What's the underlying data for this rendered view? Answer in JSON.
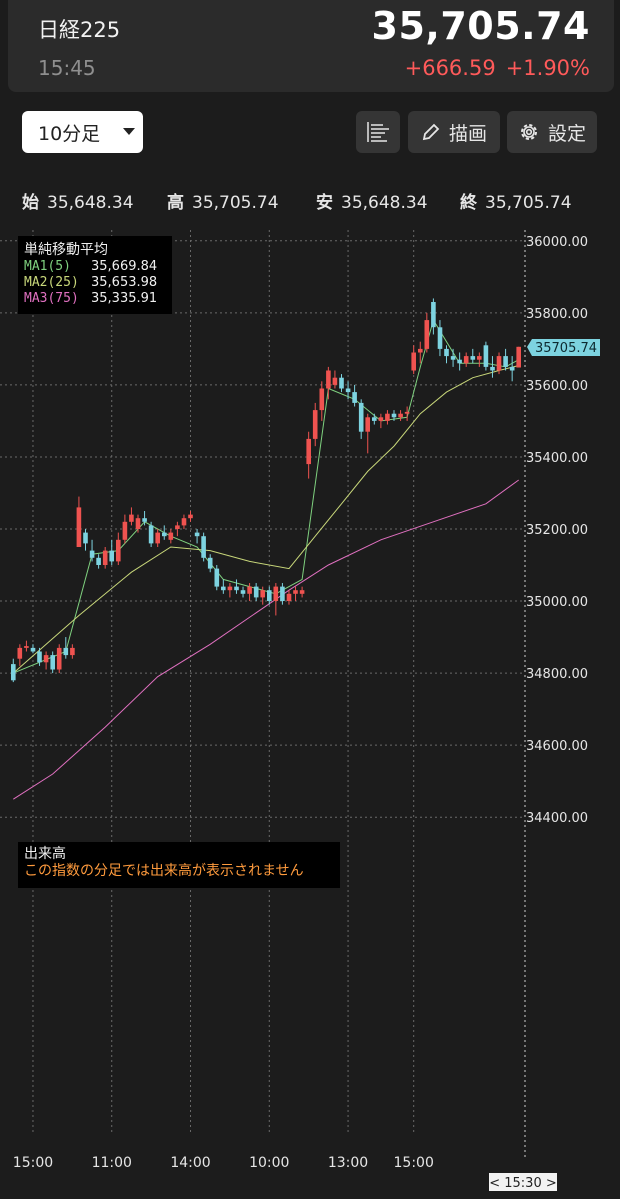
{
  "header": {
    "name": "日経225",
    "time": "15:45",
    "price": "35,705.74",
    "change": "+666.59",
    "change_pct": "+1.90%"
  },
  "toolbar": {
    "interval": "10分足",
    "draw_label": "描画",
    "settings_label": "設定"
  },
  "ohlc": {
    "open_label": "始",
    "open": "35,648.34",
    "high_label": "高",
    "high": "35,705.74",
    "low_label": "安",
    "low": "35,648.34",
    "close_label": "終",
    "close": "35,705.74"
  },
  "ma_legend": {
    "title": "単純移動平均",
    "items": [
      {
        "label": "MA1(5)",
        "value": "35,669.84",
        "color": "#7fd17f"
      },
      {
        "label": "MA2(25)",
        "value": "35,653.98",
        "color": "#c8d77a"
      },
      {
        "label": "MA3(75)",
        "value": "35,335.91",
        "color": "#e070c0"
      }
    ]
  },
  "volume": {
    "title": "出来高",
    "message": "この指数の分足では出来高が表示されません"
  },
  "colors": {
    "up": "#ef5350",
    "down": "#7dd3e0",
    "last_price_bg": "#7dd3e0"
  },
  "chart_data": {
    "type": "candlestick",
    "y_ticks": [
      34400,
      34600,
      34800,
      35000,
      35200,
      35400,
      35600,
      35800,
      36000
    ],
    "y_tick_labels": [
      "34400.00",
      "34600.00",
      "34800.00",
      "35000.00",
      "35200.00",
      "35400.00",
      "35600.00",
      "35800.00",
      "36000.00"
    ],
    "ylim": [
      34370,
      36030
    ],
    "x_tick_labels": [
      {
        "i": 3,
        "label": "15:00"
      },
      {
        "i": 15,
        "label": "11:00"
      },
      {
        "i": 27,
        "label": "14:00"
      },
      {
        "i": 39,
        "label": "10:00"
      },
      {
        "i": 51,
        "label": "13:00"
      },
      {
        "i": 61,
        "label": "15:00"
      }
    ],
    "cursor_label": "< 15:30 >",
    "last_price_label": "35705.74",
    "last_price": 35705.74,
    "candles": [
      [
        34825,
        34840,
        34775,
        34780
      ],
      [
        34840,
        34880,
        34820,
        34870
      ],
      [
        34870,
        34890,
        34860,
        34875
      ],
      [
        34870,
        34880,
        34855,
        34860
      ],
      [
        34860,
        34870,
        34820,
        34830
      ],
      [
        34830,
        34860,
        34810,
        34850
      ],
      [
        34850,
        34860,
        34800,
        34810
      ],
      [
        34810,
        34880,
        34800,
        34870
      ],
      [
        34870,
        34900,
        34840,
        34850
      ],
      [
        34850,
        34880,
        34840,
        34870
      ],
      [
        35150,
        35290,
        35150,
        35260
      ],
      [
        35190,
        35200,
        35140,
        35160
      ],
      [
        35140,
        35170,
        35110,
        35120
      ],
      [
        35120,
        35130,
        35090,
        35100
      ],
      [
        35100,
        35150,
        35090,
        35140
      ],
      [
        35140,
        35170,
        35100,
        35110
      ],
      [
        35110,
        35190,
        35100,
        35170
      ],
      [
        35170,
        35240,
        35160,
        35220
      ],
      [
        35220,
        35260,
        35210,
        35240
      ],
      [
        35200,
        35240,
        35190,
        35230
      ],
      [
        35230,
        35250,
        35210,
        35220
      ],
      [
        35210,
        35220,
        35150,
        35160
      ],
      [
        35160,
        35200,
        35150,
        35190
      ],
      [
        35190,
        35210,
        35170,
        35180
      ],
      [
        35170,
        35200,
        35160,
        35190
      ],
      [
        35200,
        35220,
        35180,
        35210
      ],
      [
        35210,
        35240,
        35200,
        35230
      ],
      [
        35230,
        35250,
        35220,
        35240
      ],
      [
        35190,
        35200,
        35160,
        35180
      ],
      [
        35180,
        35190,
        35110,
        35120
      ],
      [
        35120,
        35130,
        35080,
        35090
      ],
      [
        35090,
        35100,
        35030,
        35040
      ],
      [
        35040,
        35060,
        35020,
        35030
      ],
      [
        35030,
        35050,
        35010,
        35040
      ],
      [
        35040,
        35060,
        35020,
        35030
      ],
      [
        35030,
        35040,
        35010,
        35020
      ],
      [
        35020,
        35050,
        35000,
        35040
      ],
      [
        35040,
        35050,
        35000,
        35010
      ],
      [
        35010,
        35040,
        34990,
        35030
      ],
      [
        35030,
        35040,
        34990,
        35000
      ],
      [
        35000,
        35050,
        34960,
        35040
      ],
      [
        35040,
        35050,
        34990,
        35000
      ],
      [
        35000,
        35030,
        34990,
        35020
      ],
      [
        35020,
        35040,
        35000,
        35030
      ],
      [
        35020,
        35040,
        35010,
        35030
      ],
      [
        35380,
        35470,
        35340,
        35450
      ],
      [
        35450,
        35550,
        35430,
        35530
      ],
      [
        35530,
        35610,
        35500,
        35590
      ],
      [
        35590,
        35650,
        35560,
        35640
      ],
      [
        35600,
        35640,
        35590,
        35620
      ],
      [
        35620,
        35630,
        35580,
        35590
      ],
      [
        35590,
        35610,
        35560,
        35580
      ],
      [
        35580,
        35600,
        35540,
        35550
      ],
      [
        35550,
        35560,
        35450,
        35470
      ],
      [
        35470,
        35520,
        35410,
        35510
      ],
      [
        35510,
        35520,
        35490,
        35500
      ],
      [
        35500,
        35520,
        35480,
        35510
      ],
      [
        35500,
        35530,
        35490,
        35520
      ],
      [
        35520,
        35530,
        35500,
        35510
      ],
      [
        35510,
        35530,
        35500,
        35520
      ],
      [
        35520,
        35540,
        35500,
        35525
      ],
      [
        35640,
        35710,
        35630,
        35690
      ],
      [
        35690,
        35720,
        35660,
        35700
      ],
      [
        35700,
        35800,
        35690,
        35780
      ],
      [
        35830,
        35840,
        35740,
        35760
      ],
      [
        35760,
        35780,
        35680,
        35700
      ],
      [
        35700,
        35710,
        35660,
        35680
      ],
      [
        35680,
        35700,
        35650,
        35670
      ],
      [
        35670,
        35690,
        35640,
        35660
      ],
      [
        35660,
        35690,
        35650,
        35680
      ],
      [
        35680,
        35700,
        35660,
        35670
      ],
      [
        35670,
        35690,
        35650,
        35680
      ],
      [
        35710,
        35720,
        35640,
        35650
      ],
      [
        35650,
        35680,
        35620,
        35640
      ],
      [
        35640,
        35690,
        35630,
        35680
      ],
      [
        35680,
        35700,
        35640,
        35650
      ],
      [
        35650,
        35680,
        35610,
        35640
      ],
      [
        35648.34,
        35705.74,
        35648.34,
        35705.74
      ]
    ],
    "series": [
      {
        "name": "MA1(5)",
        "color": "#7fd17f",
        "values": [
          [
            0,
            34800
          ],
          [
            8,
            34860
          ],
          [
            12,
            35130
          ],
          [
            16,
            35140
          ],
          [
            20,
            35220
          ],
          [
            24,
            35180
          ],
          [
            28,
            35150
          ],
          [
            32,
            35060
          ],
          [
            36,
            35040
          ],
          [
            40,
            35020
          ],
          [
            44,
            35060
          ],
          [
            48,
            35590
          ],
          [
            52,
            35560
          ],
          [
            56,
            35500
          ],
          [
            60,
            35510
          ],
          [
            62,
            35650
          ],
          [
            64,
            35780
          ],
          [
            68,
            35660
          ],
          [
            72,
            35660
          ],
          [
            75,
            35650
          ],
          [
            77,
            35669.84
          ]
        ]
      },
      {
        "name": "MA2(25)",
        "color": "#c8d77a",
        "values": [
          [
            0,
            34800
          ],
          [
            10,
            34960
          ],
          [
            18,
            35080
          ],
          [
            24,
            35150
          ],
          [
            30,
            35140
          ],
          [
            36,
            35110
          ],
          [
            42,
            35090
          ],
          [
            46,
            35180
          ],
          [
            50,
            35270
          ],
          [
            54,
            35360
          ],
          [
            58,
            35430
          ],
          [
            62,
            35520
          ],
          [
            66,
            35580
          ],
          [
            70,
            35620
          ],
          [
            74,
            35640
          ],
          [
            77,
            35653.98
          ]
        ]
      },
      {
        "name": "MA3(75)",
        "color": "#e070c0",
        "values": [
          [
            0,
            34450
          ],
          [
            6,
            34520
          ],
          [
            14,
            34650
          ],
          [
            22,
            34790
          ],
          [
            30,
            34880
          ],
          [
            38,
            34980
          ],
          [
            42,
            35030
          ],
          [
            48,
            35100
          ],
          [
            56,
            35170
          ],
          [
            64,
            35220
          ],
          [
            72,
            35270
          ],
          [
            77,
            35335.91
          ]
        ]
      }
    ]
  }
}
